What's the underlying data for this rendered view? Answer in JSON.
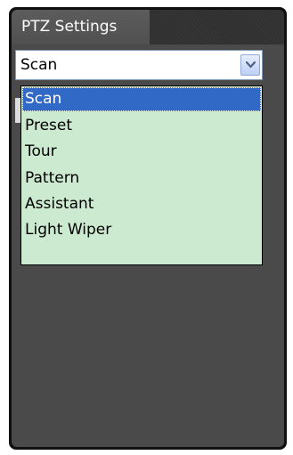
{
  "panel": {
    "tab_title": "PTZ Settings"
  },
  "select": {
    "selected_value": "Scan",
    "arrow_icon": "chevron-down-icon",
    "options": [
      {
        "label": "Scan",
        "selected": true
      },
      {
        "label": "Preset",
        "selected": false
      },
      {
        "label": "Tour",
        "selected": false
      },
      {
        "label": "Pattern",
        "selected": false
      },
      {
        "label": "Assistant",
        "selected": false
      },
      {
        "label": "Light Wiper",
        "selected": false
      }
    ]
  },
  "colors": {
    "panel_dark": "#101010",
    "panel_body": "#4a4a4a",
    "option_background": "#ccead0",
    "option_highlight": "#3169c6"
  }
}
